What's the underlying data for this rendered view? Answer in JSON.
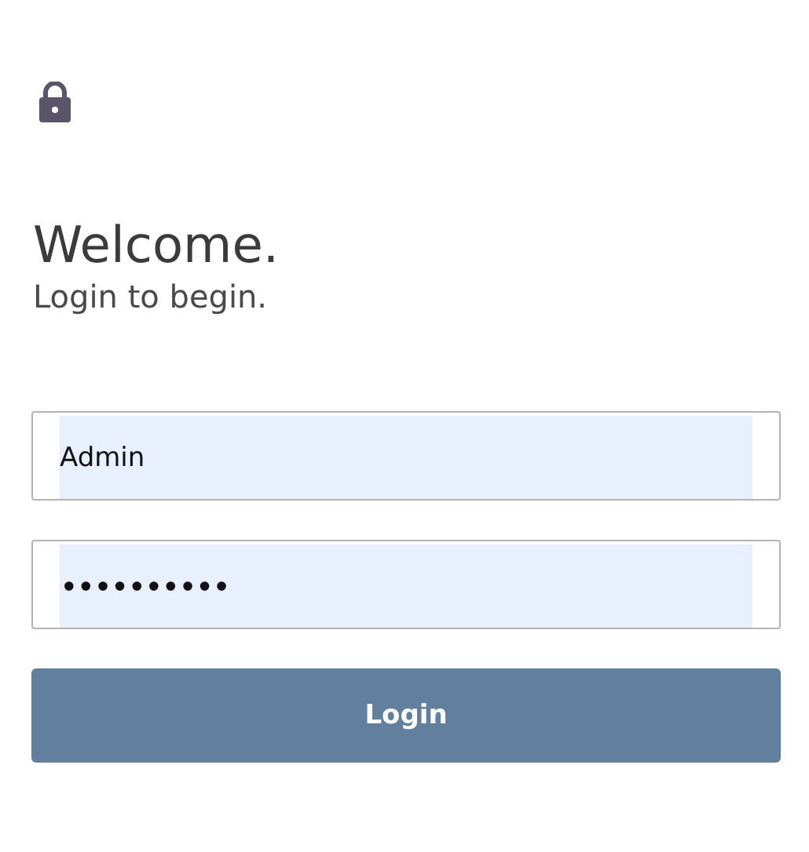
{
  "heading": "Welcome.",
  "subheading": "Login to begin.",
  "fields": [
    {
      "kind": "text",
      "value": "Admin"
    },
    {
      "kind": "password",
      "value": "••••••••••"
    }
  ],
  "button": "Login"
}
